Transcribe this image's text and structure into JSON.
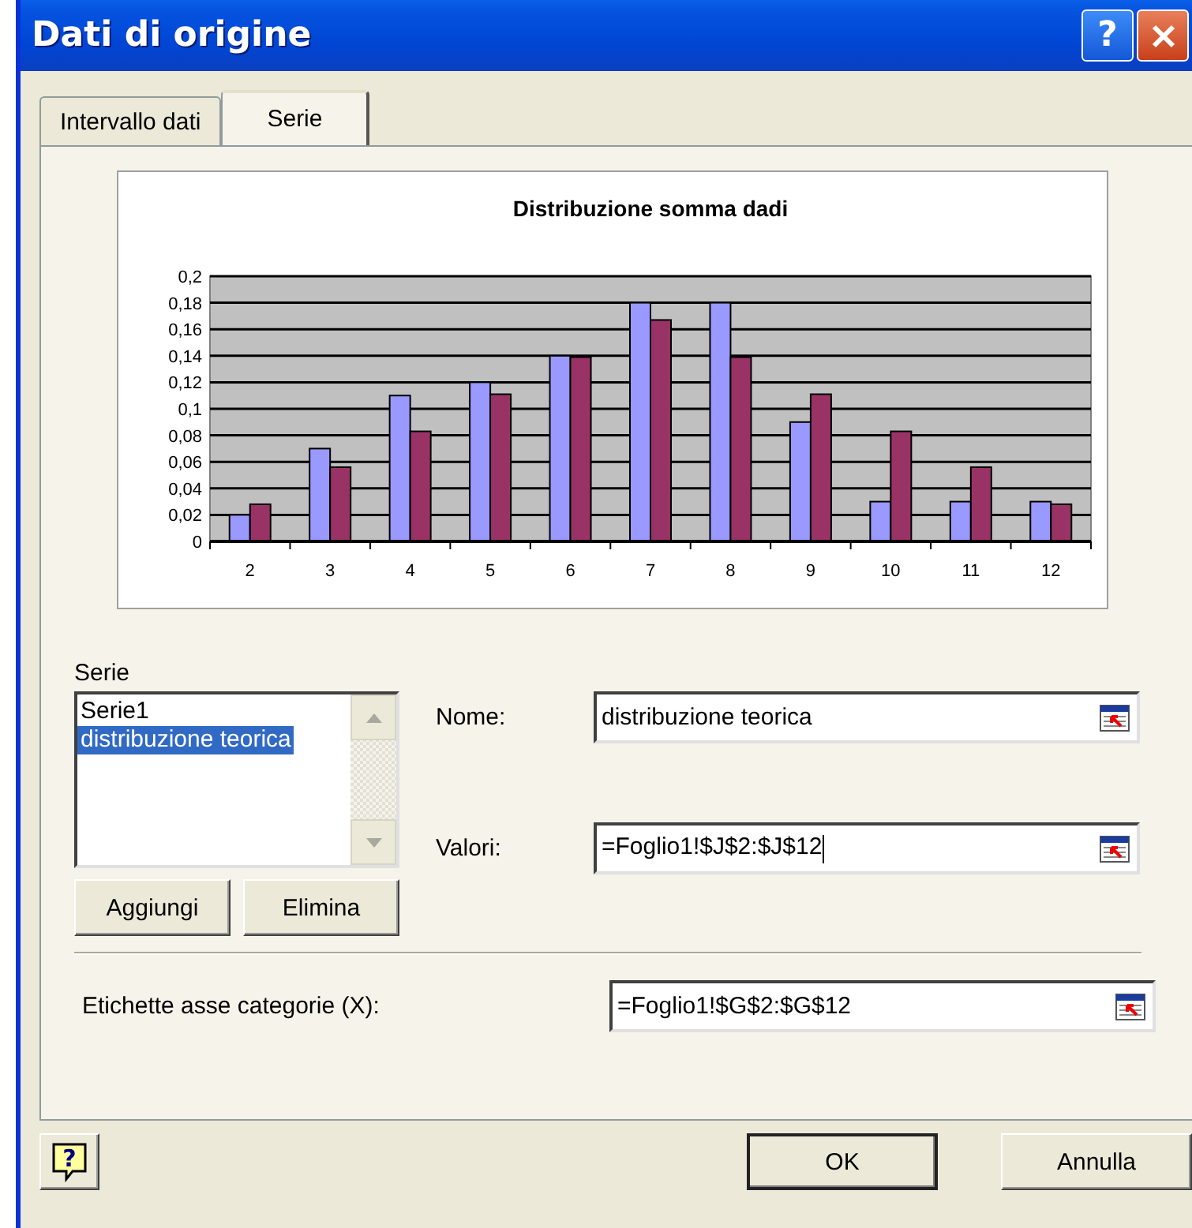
{
  "window": {
    "title": "Dati di origine",
    "help_glyph": "?"
  },
  "tabs": [
    {
      "label": "Intervallo dati",
      "selected": false
    },
    {
      "label": "Serie",
      "selected": true
    }
  ],
  "chart": {
    "chart_data": {
      "type": "bar",
      "title": "Distribuzione somma dadi",
      "categories": [
        "2",
        "3",
        "4",
        "5",
        "6",
        "7",
        "8",
        "9",
        "10",
        "11",
        "12"
      ],
      "grid": true,
      "series": [
        {
          "color": "#9999ff",
          "values": [
            0.02,
            0.07,
            0.11,
            0.12,
            0.14,
            0.18,
            0.18,
            0.09,
            0.03,
            0.03,
            0.03
          ]
        },
        {
          "color": "#993366",
          "values": [
            0.028,
            0.056,
            0.083,
            0.111,
            0.139,
            0.167,
            0.139,
            0.111,
            0.083,
            0.056,
            0.028
          ]
        }
      ],
      "ylim": [
        0,
        0.2
      ],
      "yticks": [
        {
          "value": 0,
          "label": "0"
        },
        {
          "value": 0.02,
          "label": "0,02"
        },
        {
          "value": 0.04,
          "label": "0,04"
        },
        {
          "value": 0.06,
          "label": "0,06"
        },
        {
          "value": 0.08,
          "label": "0,08"
        },
        {
          "value": 0.1,
          "label": "0,1"
        },
        {
          "value": 0.12,
          "label": "0,12"
        },
        {
          "value": 0.14,
          "label": "0,14"
        },
        {
          "value": 0.16,
          "label": "0,16"
        },
        {
          "value": 0.18,
          "label": "0,18"
        },
        {
          "value": 0.2,
          "label": "0,2"
        }
      ]
    }
  },
  "series_section": {
    "label": "Serie",
    "list": [
      {
        "label": "Serie1",
        "selected": false
      },
      {
        "label": "distribuzione teorica",
        "selected": true
      }
    ],
    "buttons": [
      "Aggiungi",
      "Elimina"
    ]
  },
  "fields": [
    {
      "label": "Nome:",
      "value": "distribuzione teorica",
      "focused": false
    },
    {
      "label": "Valori:",
      "value": "=Foglio1!$J$2:$J$12",
      "focused": true
    }
  ],
  "category_field": {
    "label": "Etichette asse categorie (X):",
    "value": "=Foglio1!$G$2:$G$12",
    "focused": false
  },
  "footer": {
    "help_glyph": "?",
    "buttons": [
      {
        "label": "OK",
        "default": true
      },
      {
        "label": "Annulla",
        "default": false
      }
    ]
  }
}
